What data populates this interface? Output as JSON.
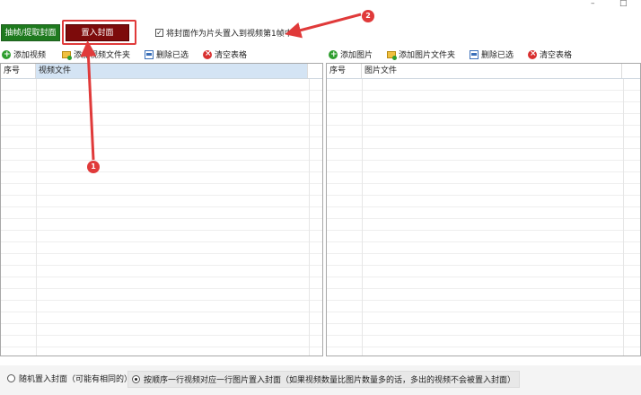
{
  "window": {
    "minimize_glyph": "–",
    "close_glyph": "□"
  },
  "mode_tabs": {
    "extract_label": "抽帧/提取封面",
    "embed_label": "置入封面"
  },
  "options": {
    "first_frame_label": "将封面作为片头置入到视频第1帧中",
    "first_frame_checked": true
  },
  "video_toolbar": {
    "add": "添加视频",
    "add_folder": "添加视频文件夹",
    "delete_selected": "删除已选",
    "clear": "清空表格"
  },
  "image_toolbar": {
    "add": "添加图片",
    "add_folder": "添加图片文件夹",
    "delete_selected": "删除已选",
    "clear": "清空表格"
  },
  "video_table": {
    "col_index": "序号",
    "col_file": "视频文件"
  },
  "image_table": {
    "col_index": "序号",
    "col_file": "图片文件"
  },
  "bottom": {
    "random_label": "随机置入封面（可能有相同的）",
    "sequential_label": "按顺序一行视频对应一行图片置入封面（如果视频数量比图片数量多的话，多出的视频不会被置入封面）",
    "selected": "sequential"
  },
  "annotations": {
    "marker_1": "1",
    "marker_2": "2"
  },
  "colors": {
    "extract_green": "#1e7a1e",
    "embed_darkred": "#7d0b0b",
    "annotation_red": "#e03a3a",
    "selected_header": "#d4e4f4"
  }
}
